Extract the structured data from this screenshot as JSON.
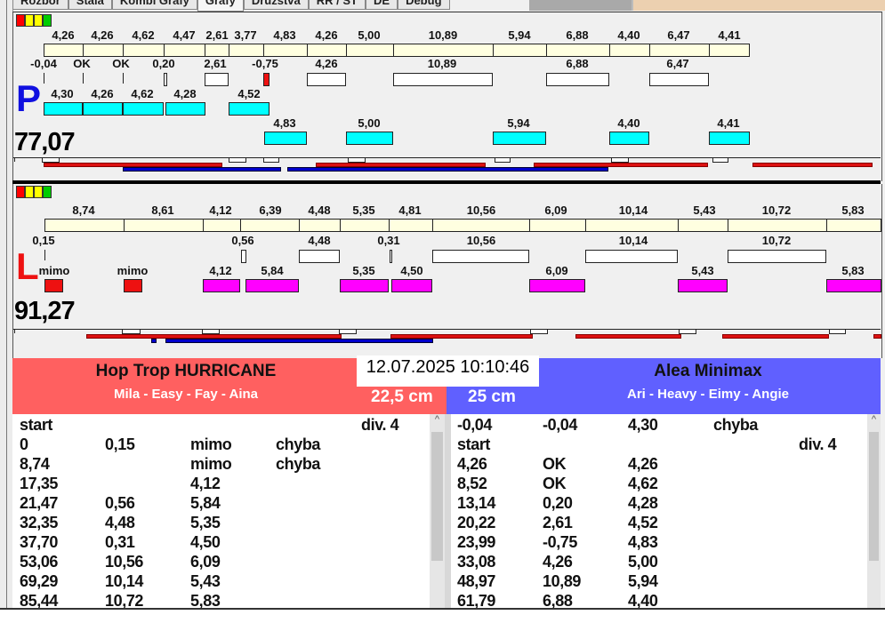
{
  "tabs": [
    "Rozbor",
    "Stála",
    "Kombi Grafy",
    "Grafy",
    "Družstva",
    "RR / ST",
    "DE",
    "Debug"
  ],
  "colors": {
    "squares": [
      "#ff0000",
      "#ffff00",
      "#ffff00",
      "#00cc00"
    ],
    "team_left": "#ff6060",
    "team_right": "#6060ff",
    "cyan": "#00ffff",
    "magenta": "#ff00ff",
    "red": "#dd1111",
    "blue": "#0000cc"
  },
  "panels": [
    {
      "letter": "P",
      "total": "77,07",
      "row1": [
        "4,26",
        "4,26",
        "4,62",
        "4,47",
        "2,61",
        "3,77",
        "4,83",
        "4,26",
        "5,00",
        "10,89",
        "5,94",
        "6,88",
        "4,40",
        "6,47",
        "4,41"
      ],
      "row2": [
        "-0,04",
        "OK",
        "OK",
        "0,20",
        "2,61",
        "-0,75",
        "4,26",
        "10,89",
        "6,88",
        "6,47"
      ],
      "row3": [
        "4,30",
        "4,26",
        "4,62",
        "4,28",
        "4,52"
      ],
      "row4": [
        "4,83",
        "5,00",
        "5,94",
        "4,40",
        "4,41"
      ]
    },
    {
      "letter": "L",
      "total": "91,27",
      "row1": [
        "8,74",
        "8,61",
        "4,12",
        "6,39",
        "4,48",
        "5,35",
        "4,81",
        "10,56",
        "6,09",
        "10,14",
        "5,43",
        "10,72",
        "5,83"
      ],
      "row2": [
        "0,15",
        "0,56",
        "4,48",
        "0,31",
        "10,56",
        "10,14",
        "10,72"
      ],
      "row3": [
        "mimo",
        "mimo",
        "4,12",
        "5,84",
        "5,35",
        "4,50",
        "6,09",
        "5,43",
        "5,83"
      ],
      "row4": []
    }
  ],
  "date": "12.07.2025 10:10:46",
  "teams": [
    {
      "name": "Hop Trop HURRICANE",
      "players": "Mila - Easy - Fay - Aina",
      "distance": "22,5 cm",
      "rows": [
        [
          "start",
          "",
          "",
          "",
          "div. 4"
        ],
        [
          "0",
          "0,15",
          "mimo",
          "chyba",
          ""
        ],
        [
          "8,74",
          "",
          "mimo",
          "chyba",
          ""
        ],
        [
          "17,35",
          "",
          "4,12",
          "",
          ""
        ],
        [
          "21,47",
          "0,56",
          "5,84",
          "",
          ""
        ],
        [
          "32,35",
          "4,48",
          "5,35",
          "",
          ""
        ],
        [
          "37,70",
          "0,31",
          "4,50",
          "",
          ""
        ],
        [
          "53,06",
          "10,56",
          "6,09",
          "",
          ""
        ],
        [
          "69,29",
          "10,14",
          "5,43",
          "",
          ""
        ],
        [
          "85,44",
          "10,72",
          "5,83",
          "",
          ""
        ]
      ]
    },
    {
      "name": "Alea Minimax",
      "players": "Ari - Heavy - Eimy - Angie",
      "distance": "25 cm",
      "rows": [
        [
          "-0,04",
          "-0,04",
          "4,30",
          "chyba",
          ""
        ],
        [
          "start",
          "",
          "",
          "",
          "div. 4"
        ],
        [
          "4,26",
          "OK",
          "4,26",
          "",
          ""
        ],
        [
          "8,52",
          "OK",
          "4,62",
          "",
          ""
        ],
        [
          "13,14",
          "0,20",
          "4,28",
          "",
          ""
        ],
        [
          "20,22",
          "2,61",
          "4,52",
          "",
          ""
        ],
        [
          "23,99",
          "-0,75",
          "4,83",
          "",
          ""
        ],
        [
          "33,08",
          "4,26",
          "5,00",
          "",
          ""
        ],
        [
          "48,97",
          "10,89",
          "5,94",
          "",
          ""
        ],
        [
          "61,79",
          "6,88",
          "4,40",
          "",
          ""
        ]
      ]
    }
  ]
}
